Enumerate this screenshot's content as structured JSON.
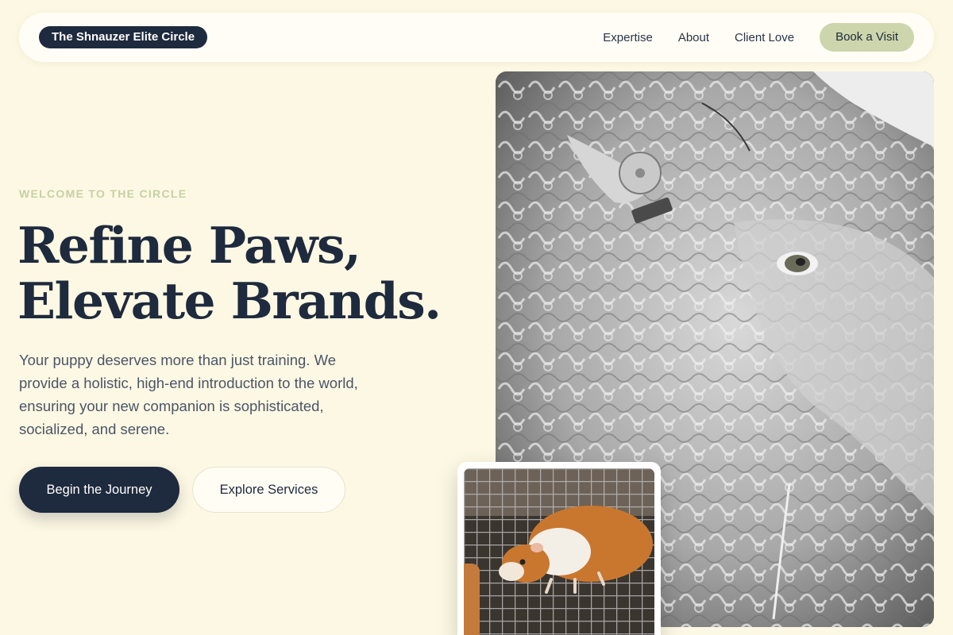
{
  "nav": {
    "brand": "The Shnauzer Elite Circle",
    "links": [
      "Expertise",
      "About",
      "Client Love"
    ],
    "cta": "Book a Visit"
  },
  "hero": {
    "eyebrow": "WELCOME TO THE CIRCLE",
    "headline_line1": "Refine Paws,",
    "headline_line2": "Elevate Brands.",
    "lede": "Your puppy deserves more than just training. We provide a holistic, high-end introduction to the world, ensuring your new companion is sophisticated, socialized, and serene.",
    "primary_button": "Begin the Journey",
    "secondary_button": "Explore Services"
  },
  "colors": {
    "background": "#fdf8e3",
    "navy": "#1e2a3d",
    "sage": "#cdd5ac",
    "eyebrow": "#c7d0a6"
  }
}
